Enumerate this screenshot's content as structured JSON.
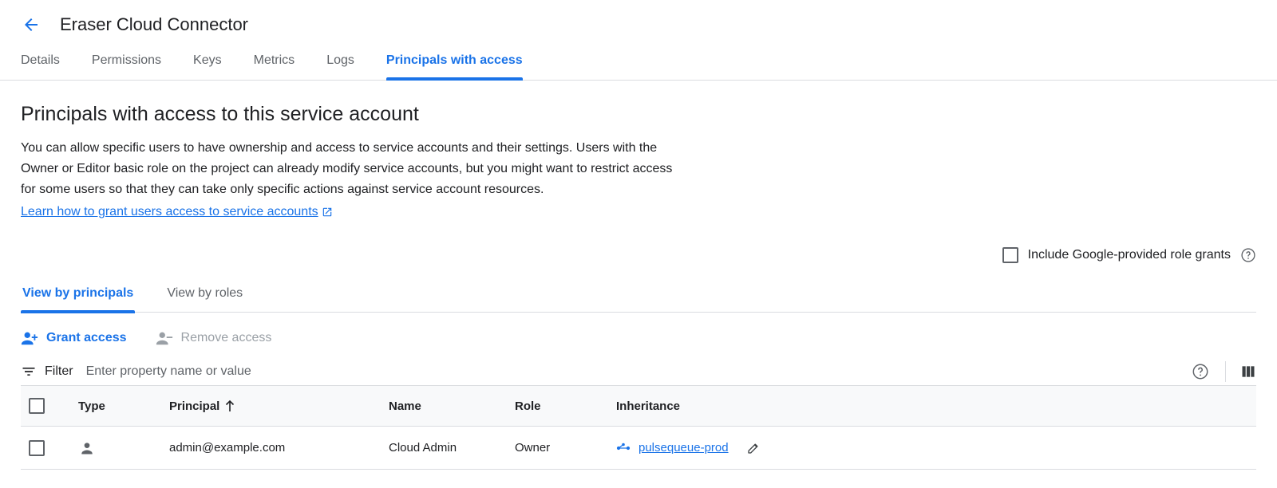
{
  "header": {
    "title": "Eraser Cloud Connector",
    "tabs": [
      {
        "label": "Details"
      },
      {
        "label": "Permissions"
      },
      {
        "label": "Keys"
      },
      {
        "label": "Metrics"
      },
      {
        "label": "Logs"
      },
      {
        "label": "Principals with access",
        "active": true
      }
    ]
  },
  "section": {
    "title": "Principals with access to this service account",
    "description": "You can allow specific users to have ownership and access to service accounts and their settings. Users with the Owner or Editor basic role on the project can already modify service accounts, but you might want to restrict access for some users so that they can take only specific actions against service account resources.",
    "learn_link": "Learn how to grant users access to service accounts"
  },
  "include_google_grants": {
    "label": "Include Google-provided role grants",
    "checked": false
  },
  "subtabs": [
    {
      "label": "View by principals",
      "active": true
    },
    {
      "label": "View by roles"
    }
  ],
  "actions": {
    "grant": "Grant access",
    "remove": "Remove access"
  },
  "filter": {
    "label": "Filter",
    "placeholder": "Enter property name or value"
  },
  "table": {
    "columns": [
      "Type",
      "Principal",
      "Name",
      "Role",
      "Inheritance"
    ],
    "sort_column": "Principal",
    "rows": [
      {
        "type_icon": "person-icon",
        "principal": "admin@example.com",
        "name": "Cloud Admin",
        "role": "Owner",
        "inheritance": "pulsequeue-prod"
      }
    ]
  },
  "colors": {
    "accent": "#1a73e8",
    "text": "#202124",
    "secondary_text": "#5f6368",
    "disabled": "#9aa0a6",
    "divider": "#dadce0"
  }
}
